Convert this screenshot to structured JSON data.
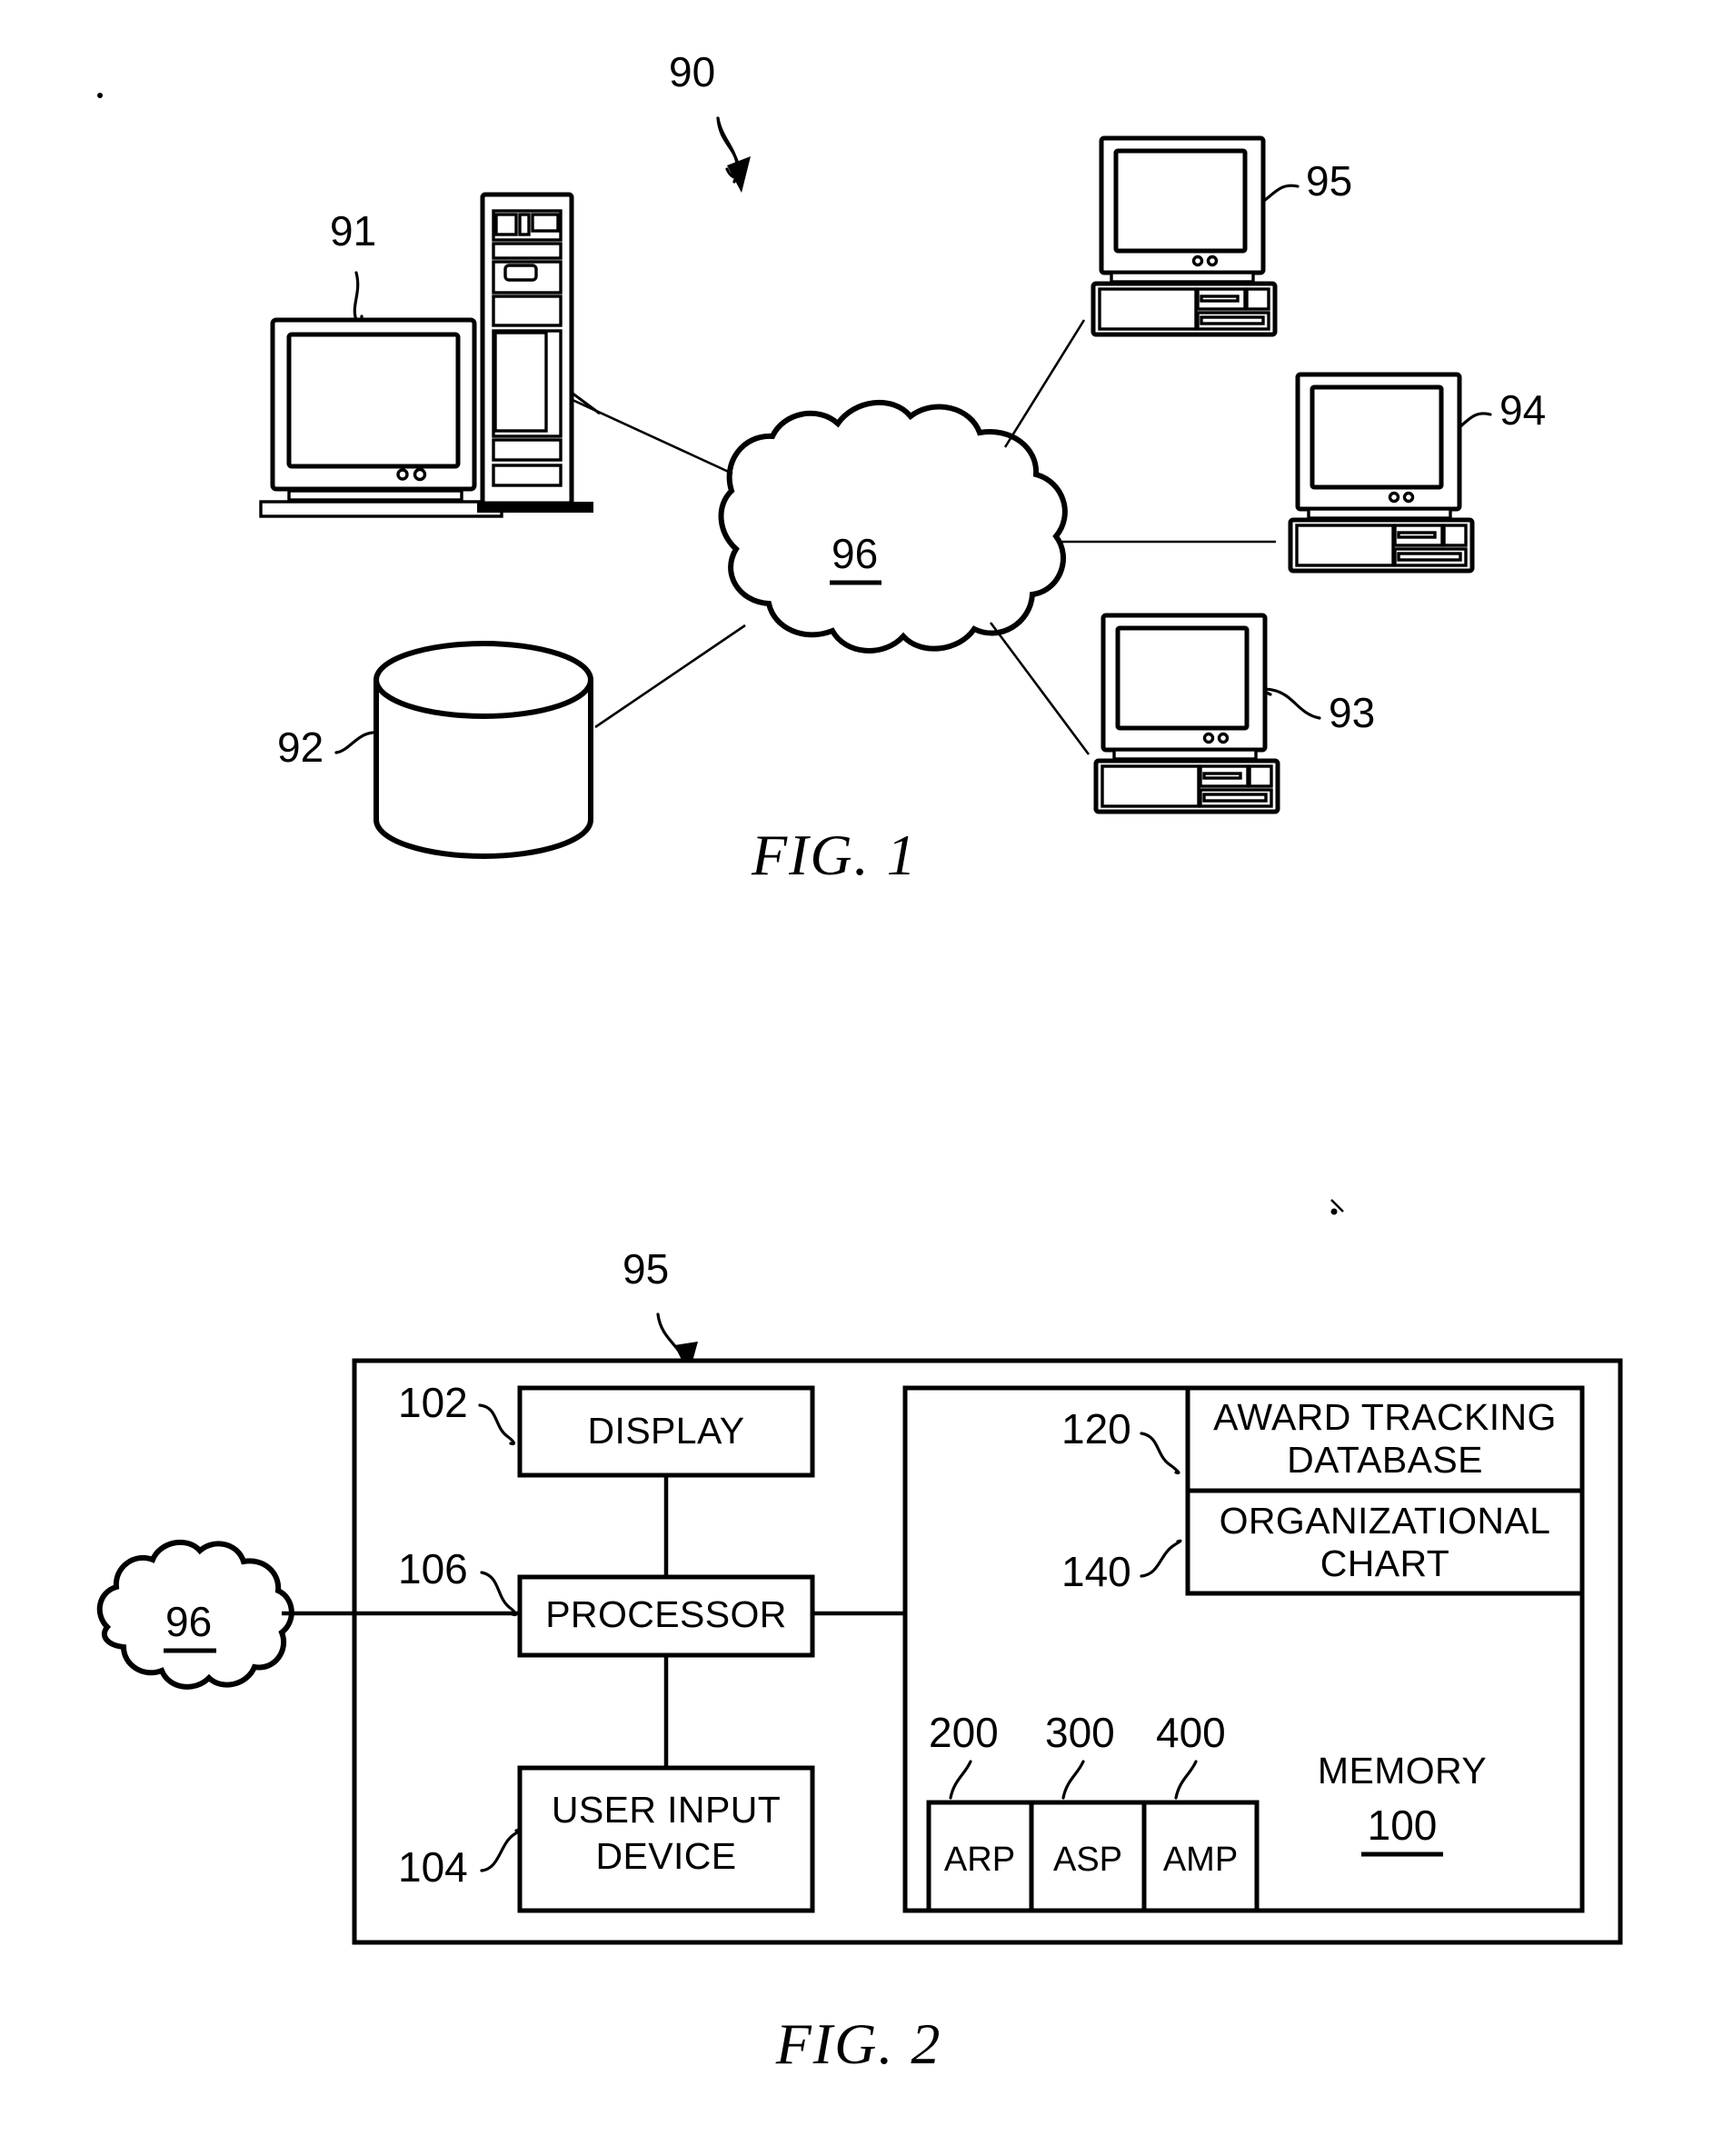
{
  "document": {
    "type": "patent-figure-sheet",
    "figures": [
      {
        "caption": "FIG. 1",
        "title_ref": "90",
        "nodes": [
          {
            "ref": "91",
            "name": "server-workstation"
          },
          {
            "ref": "92",
            "name": "database-cylinder"
          },
          {
            "ref": "93",
            "name": "client-computer"
          },
          {
            "ref": "94",
            "name": "client-computer"
          },
          {
            "ref": "95",
            "name": "client-computer"
          },
          {
            "ref": "96",
            "name": "network-cloud",
            "underlined": true
          }
        ]
      },
      {
        "caption": "FIG. 2",
        "title_ref": "95",
        "cloud_ref": "96",
        "blocks": [
          {
            "ref": "102",
            "label": "DISPLAY"
          },
          {
            "ref": "106",
            "label": "PROCESSOR"
          },
          {
            "ref": "104",
            "label_line1": "USER INPUT",
            "label_line2": "DEVICE"
          },
          {
            "ref": "120",
            "label_line1": "AWARD TRACKING",
            "label_line2": "DATABASE"
          },
          {
            "ref": "140",
            "label_line1": "ORGANIZATIONAL",
            "label_line2": "CHART"
          },
          {
            "ref": "200",
            "label": "ARP"
          },
          {
            "ref": "300",
            "label": "ASP"
          },
          {
            "ref": "400",
            "label": "AMP"
          }
        ],
        "memory": {
          "label": "MEMORY",
          "ref": "100",
          "underlined": true
        }
      }
    ]
  },
  "fig1": {
    "caption": "FIG. 1",
    "ref_90": "90",
    "ref_91": "91",
    "ref_92": "92",
    "ref_93": "93",
    "ref_94": "94",
    "ref_95": "95",
    "ref_96": "96"
  },
  "fig2": {
    "caption": "FIG. 2",
    "ref_95": "95",
    "ref_96": "96",
    "ref_102": "102",
    "ref_104": "104",
    "ref_106": "106",
    "ref_120": "120",
    "ref_140": "140",
    "ref_200": "200",
    "ref_300": "300",
    "ref_400": "400",
    "ref_100": "100",
    "label_display": "DISPLAY",
    "label_processor": "PROCESSOR",
    "label_user_input_1": "USER INPUT",
    "label_user_input_2": "DEVICE",
    "label_award_1": "AWARD TRACKING",
    "label_award_2": "DATABASE",
    "label_org_1": "ORGANIZATIONAL",
    "label_org_2": "CHART",
    "label_arp": "ARP",
    "label_asp": "ASP",
    "label_amp": "AMP",
    "label_memory": "MEMORY"
  },
  "colors": {
    "ink": "#000000",
    "paper": "#ffffff"
  }
}
